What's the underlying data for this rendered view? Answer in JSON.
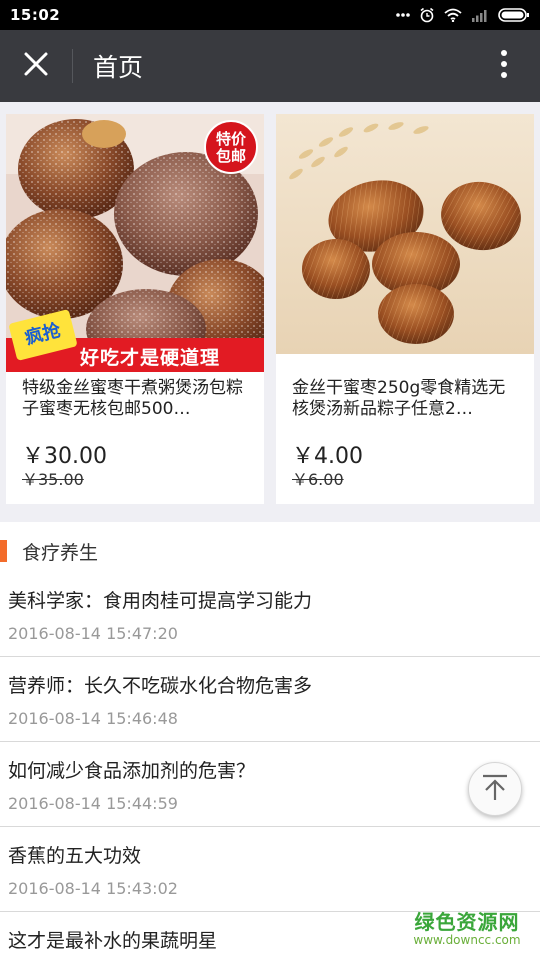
{
  "status_bar": {
    "time": "15:02",
    "icons": [
      "more-dots-icon",
      "alarm-icon",
      "wifi-icon",
      "signal-icon",
      "battery-icon"
    ]
  },
  "app_bar": {
    "title": "首页",
    "close_icon": "close-icon",
    "menu_icon": "more-vertical-icon"
  },
  "products": [
    {
      "name": "特级金丝蜜枣干煮粥煲汤包粽子蜜枣无核包邮500…",
      "price": "￥30.00",
      "old_price": "￥35.00",
      "badge": "特价包邮",
      "sticker": "疯抢",
      "banner": "好吃才是硬道理"
    },
    {
      "name": "金丝干蜜枣250g零食精选无核煲汤新品粽子任意2…",
      "price": "￥4.00",
      "old_price": "￥6.00"
    }
  ],
  "section": {
    "title": "食疗养生",
    "accent_color": "#f36c2b"
  },
  "news": [
    {
      "title": "美科学家：食用肉桂可提高学习能力",
      "time": "2016-08-14 15:47:20"
    },
    {
      "title": "营养师：长久不吃碳水化合物危害多",
      "time": "2016-08-14 15:46:48"
    },
    {
      "title": "如何减少食品添加剂的危害？",
      "time": "2016-08-14 15:44:59"
    },
    {
      "title": "香蕉的五大功效",
      "time": "2016-08-14 15:43:02"
    },
    {
      "title": "这才是最补水的果蔬明星",
      "time": ""
    }
  ],
  "back_to_top_icon": "arrow-up-icon",
  "watermark": {
    "line1": "绿色资源网",
    "line2": "www.downcc.com"
  }
}
